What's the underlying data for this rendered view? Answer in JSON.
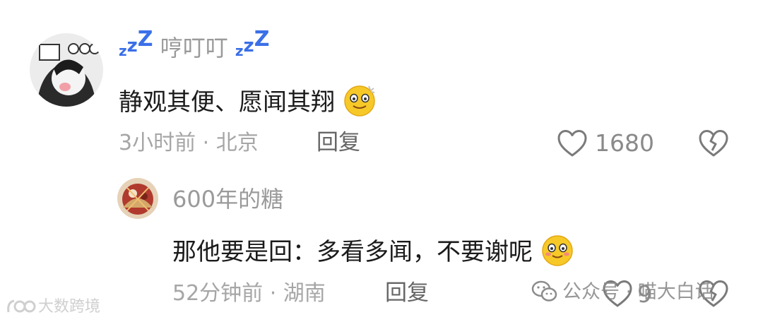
{
  "comments": [
    {
      "username": "哼叮叮",
      "username_decoration": "zZZ",
      "text": "静观其便、愿闻其翔",
      "emoji_icon": "dizzy-smile-emoji",
      "time_location": "3小时前 · 北京",
      "reply_label": "回复",
      "like_count": "1680"
    },
    {
      "username": "600年的糖",
      "text": "那他要是回：多看多闻，不要谢呢",
      "emoji_icon": "blush-smile-emoji",
      "time_location": "52分钟前 · 湖南",
      "reply_label": "回复",
      "like_count": "9"
    }
  ],
  "watermarks": {
    "bottom_left": "大数跨境",
    "bottom_right": "公众号 · 喵大白话"
  },
  "colors": {
    "username": "#9a9a9a",
    "text": "#1b1b1b",
    "meta": "#a6a6a6",
    "zzz": "#3a6fe8",
    "emoji": "#f7c928"
  }
}
